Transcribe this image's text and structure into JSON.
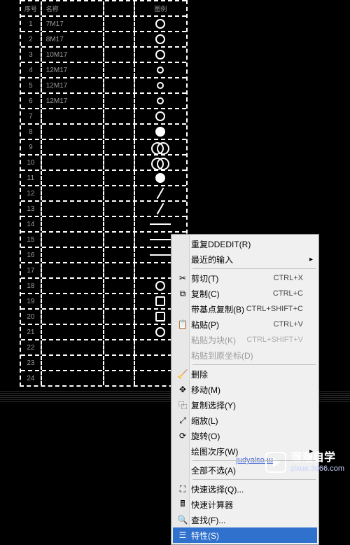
{
  "table": {
    "header": [
      "序号",
      "名称",
      "",
      "图例"
    ],
    "rows": [
      {
        "n": "1",
        "t": "7M17",
        "sym": "circle"
      },
      {
        "n": "2",
        "t": "8M17",
        "sym": "circle"
      },
      {
        "n": "3",
        "t": "10M17",
        "sym": "circle"
      },
      {
        "n": "4",
        "t": "12M17",
        "sym": "circle-sm"
      },
      {
        "n": "5",
        "t": "12M17",
        "sym": "circle-sm"
      },
      {
        "n": "6",
        "t": "12M17",
        "sym": "circle-sm"
      },
      {
        "n": "7",
        "t": "",
        "sym": "circle"
      },
      {
        "n": "8",
        "t": "",
        "sym": "filled"
      },
      {
        "n": "9",
        "t": "",
        "sym": "dbl"
      },
      {
        "n": "10",
        "t": "",
        "sym": "dbl"
      },
      {
        "n": "11",
        "t": "",
        "sym": "filled"
      },
      {
        "n": "12",
        "t": "",
        "sym": "slash"
      },
      {
        "n": "13",
        "t": "",
        "sym": "slash"
      },
      {
        "n": "14",
        "t": "",
        "sym": "line"
      },
      {
        "n": "15",
        "t": "",
        "sym": "line"
      },
      {
        "n": "16",
        "t": "",
        "sym": "line"
      },
      {
        "n": "17",
        "t": "",
        "sym": ""
      },
      {
        "n": "18",
        "t": "",
        "sym": "circle"
      },
      {
        "n": "19",
        "t": "",
        "sym": "sq"
      },
      {
        "n": "20",
        "t": "",
        "sym": "sq"
      },
      {
        "n": "21",
        "t": "",
        "sym": "circle"
      },
      {
        "n": "22",
        "t": "",
        "sym": ""
      },
      {
        "n": "23",
        "t": "",
        "sym": ""
      },
      {
        "n": "24",
        "t": "",
        "sym": ""
      }
    ]
  },
  "menu": {
    "repeat": "重复DDEDIT(R)",
    "recent": "最近的输入",
    "cut": "剪切(T)",
    "cut_key": "CTRL+X",
    "copy": "复制(C)",
    "copy_key": "CTRL+C",
    "copybase": "带基点复制(B)",
    "copybase_key": "CTRL+SHIFT+C",
    "paste": "粘贴(P)",
    "paste_key": "CTRL+V",
    "pasteblock": "粘贴为块(K)",
    "pasteblock_key": "CTRL+SHIFT+V",
    "pasteorig": "粘贴到原坐标(D)",
    "delete": "删除",
    "move": "移动(M)",
    "copysel": "复制选择(Y)",
    "scale": "缩放(L)",
    "rotate": "旋转(O)",
    "draworder": "绘图次序(W)",
    "deselect": "全部不选(A)",
    "quicksel": "快速选择(Q)...",
    "quickcalc": "快速计算器",
    "find": "查找(F)...",
    "properties": "特性(S)"
  },
  "icons": {
    "cut": "✂",
    "copy": "⧉",
    "paste": "📋",
    "delete": "🧹",
    "move": "✥",
    "copysel": "⿻",
    "scale": "⤢",
    "rotate": "⟳",
    "quicksel": "⛶",
    "quickcalc": "🖩",
    "find": "🔍",
    "properties": "☰"
  },
  "watermark": {
    "name": "溜溜自学",
    "url": "zixue.3d66.com"
  },
  "statuslink": "judyalsoau"
}
